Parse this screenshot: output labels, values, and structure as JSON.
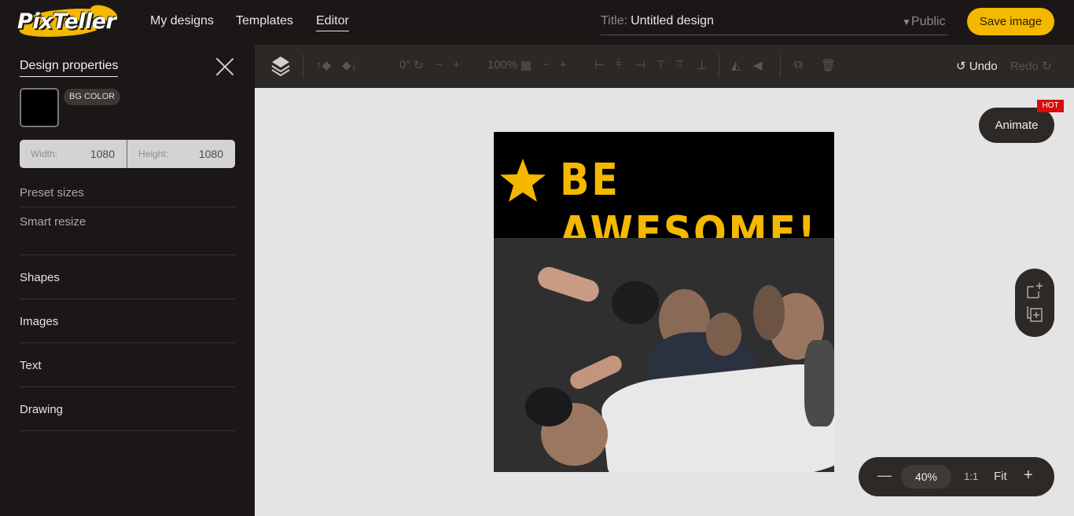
{
  "app": {
    "logo_text": "PixTeller",
    "nav": [
      {
        "label": "My designs"
      },
      {
        "label": "Templates"
      },
      {
        "label": "Editor"
      }
    ],
    "title_label": "Title:",
    "title_value": "Untitled design",
    "visibility": "Public",
    "save_label": "Save image"
  },
  "panel": {
    "title": "Design properties",
    "bg_color_label": "BG COLOR",
    "bg_color": "#000000",
    "width_label": "Width:",
    "width_value": "1080",
    "height_label": "Height:",
    "height_value": "1080",
    "preset_sizes": "Preset sizes",
    "smart_resize": "Smart resize",
    "items": [
      {
        "label": "Shapes"
      },
      {
        "label": "Images"
      },
      {
        "label": "Text"
      },
      {
        "label": "Drawing"
      }
    ]
  },
  "toolbar": {
    "rotation": "0°",
    "opacity": "100%",
    "undo_label": "Undo",
    "redo_label": "Redo",
    "icons": [
      "layers-icon",
      "bring-forward-icon",
      "send-backward-icon",
      "rotate-icon",
      "opacity-icon",
      "align-left-icon",
      "align-center-icon",
      "align-right-icon",
      "align-top-icon",
      "align-middle-icon",
      "align-bottom-icon",
      "flip-horizontal-icon",
      "flip-vertical-icon",
      "duplicate-icon",
      "delete-icon"
    ]
  },
  "canvas": {
    "headline": "BE AWESOME!",
    "accent_color": "#f5b800",
    "animate_label": "Animate",
    "hot_badge": "HOT",
    "zoom_value": "40%",
    "zoom_ratio": "1:1",
    "zoom_fit": "Fit"
  }
}
